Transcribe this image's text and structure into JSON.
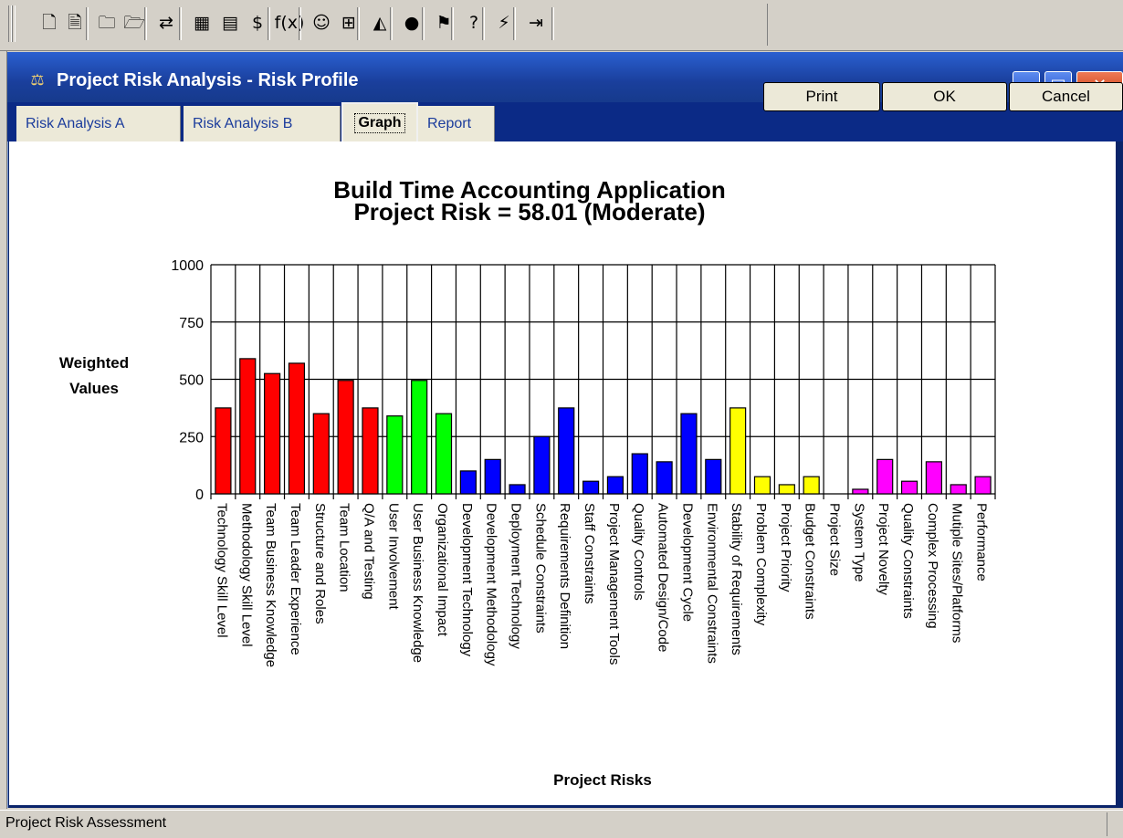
{
  "toolbar": {
    "buttons": [
      {
        "icon": "new-file-icon",
        "glyph": "🗋"
      },
      {
        "icon": "document-icon",
        "glyph": "🗎"
      },
      {
        "icon": "new-folder-icon",
        "glyph": "🗀"
      },
      {
        "icon": "open-folder-icon",
        "glyph": "🗁"
      },
      {
        "icon": "import-icon",
        "glyph": "⇄"
      },
      {
        "icon": "calculator-icon",
        "glyph": "▦"
      },
      {
        "icon": "table-icon",
        "glyph": "▤"
      },
      {
        "icon": "money-bag-icon",
        "glyph": "$"
      },
      {
        "icon": "function-icon",
        "glyph": "f(x)"
      },
      {
        "icon": "people-icon",
        "glyph": "☺"
      },
      {
        "icon": "tree-icon",
        "glyph": "⊞"
      },
      {
        "icon": "chart-icon",
        "glyph": "◭"
      },
      {
        "icon": "risk-icon",
        "glyph": "●"
      },
      {
        "icon": "flag-icon",
        "glyph": "⚑"
      },
      {
        "icon": "help-icon",
        "glyph": "?"
      },
      {
        "icon": "runner-icon",
        "glyph": "⚡"
      },
      {
        "icon": "exit-icon",
        "glyph": "⇥"
      }
    ]
  },
  "window": {
    "title": "Project Risk Analysis - Risk Profile",
    "icon": "scales-icon",
    "tabs": [
      {
        "label": "Risk Analysis A",
        "active": false
      },
      {
        "label": "Risk Analysis B",
        "active": false
      },
      {
        "label": "Graph",
        "active": true
      },
      {
        "label": "Report",
        "active": false
      }
    ],
    "buttons": {
      "print": "Print",
      "ok": "OK",
      "cancel": "Cancel"
    }
  },
  "chart_data": {
    "type": "bar",
    "title": "Build Time Accounting Application",
    "subtitle": "Project Risk = 58.01 (Moderate)",
    "ylabel": [
      "Weighted",
      "Values"
    ],
    "xlabel": "Project Risks",
    "ylim": [
      0,
      1000
    ],
    "yticks": [
      0,
      250,
      500,
      750,
      1000
    ],
    "grid": true,
    "bar_colors": {
      "red": "#ff0000",
      "green": "#00ff00",
      "blue": "#0000ff",
      "yellow": "#ffff00",
      "magenta": "#ff00ff"
    },
    "categories": [
      "Technology Skill Level",
      "Methodology Skill Level",
      "Team Business Knowledge",
      "Team Leader Experience",
      "Structure and Roles",
      "Team Location",
      "Q/A and Testing",
      "User Involvement",
      "User Business Knowledge",
      "Organizational Impact",
      "Development Technology",
      "Development Methodology",
      "Deployment Technology",
      "Schedule Constraints",
      "Requirements Definition",
      "Staff Constraints",
      "Project Management Tools",
      "Quality Controls",
      "Automated Design/Code",
      "Development Cycle",
      "Environmental Constraints",
      "Stability of Requirements",
      "Problem Complexity",
      "Project Priority",
      "Budget Constraints",
      "Project Size",
      "System Type",
      "Project Novelty",
      "Quality Constraints",
      "Complex Processing",
      "Mutiple Sites/Platforms",
      "Performance"
    ],
    "values": [
      375,
      590,
      525,
      570,
      350,
      495,
      375,
      340,
      495,
      350,
      100,
      150,
      40,
      250,
      375,
      55,
      75,
      175,
      140,
      350,
      150,
      375,
      75,
      40,
      75,
      0,
      20,
      150,
      55,
      140,
      40,
      75
    ],
    "colors": [
      "red",
      "red",
      "red",
      "red",
      "red",
      "red",
      "red",
      "green",
      "green",
      "green",
      "blue",
      "blue",
      "blue",
      "blue",
      "blue",
      "blue",
      "blue",
      "blue",
      "blue",
      "blue",
      "blue",
      "yellow",
      "yellow",
      "yellow",
      "yellow",
      "yellow",
      "magenta",
      "magenta",
      "magenta",
      "magenta",
      "magenta",
      "magenta"
    ]
  },
  "status": {
    "text": "Project Risk Assessment"
  }
}
